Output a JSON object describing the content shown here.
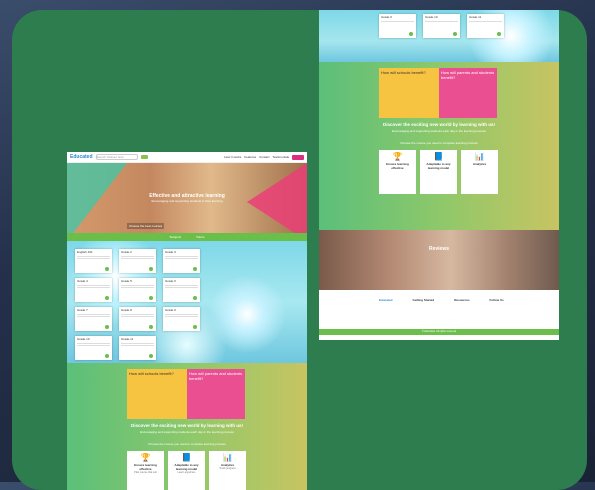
{
  "site": {
    "logo": "Educated",
    "search_placeholder": "Search classes here",
    "nav_links": [
      "How it works",
      "Features",
      "Contact",
      "Testimonials"
    ],
    "nav_button": "Join"
  },
  "hero": {
    "title": "Effective and attractive learning",
    "subtitle": "Encouraging and supporting students in their learning",
    "badge": "Choose the best courses",
    "bar_links": [
      "Subjects",
      "Tutors"
    ]
  },
  "cards": [
    {
      "title": "English 101"
    },
    {
      "title": "Grade 2"
    },
    {
      "title": "Grade 3"
    },
    {
      "title": "Grade 4"
    },
    {
      "title": "Grade 5"
    },
    {
      "title": "Grade 6"
    },
    {
      "title": "Grade 7"
    },
    {
      "title": "Grade 8"
    },
    {
      "title": "Grade 9"
    },
    {
      "title": "Grade 10"
    },
    {
      "title": "Grade 11"
    }
  ],
  "panels": {
    "yellow": "How will schools benefit?",
    "pink": "How will parents and students benefit?"
  },
  "discover": {
    "title": "Discover the exciting new world by learning with us!",
    "subtitle": "Encouraging and supporting students each day in the learning process",
    "small": "Choose the course you need to complete learning process"
  },
  "features": [
    {
      "icon": "trophy-icon",
      "glyph": "🏆",
      "title": "Ensure learning effective",
      "desc": "Plan course that suit"
    },
    {
      "icon": "book-icon",
      "glyph": "📘",
      "title": "Adaptable to any learning model",
      "desc": "Learn anywhere"
    },
    {
      "icon": "chart-icon",
      "glyph": "📊",
      "title": "Analytics",
      "desc": "Track progress"
    }
  ],
  "reviews": {
    "title": "Reviews"
  },
  "footer": {
    "brand": "Educated",
    "col1_head": "Getting Started",
    "col2_head": "Resources",
    "col3_head": "Follow Us",
    "copyright": "© Educated. All rights reserved"
  }
}
